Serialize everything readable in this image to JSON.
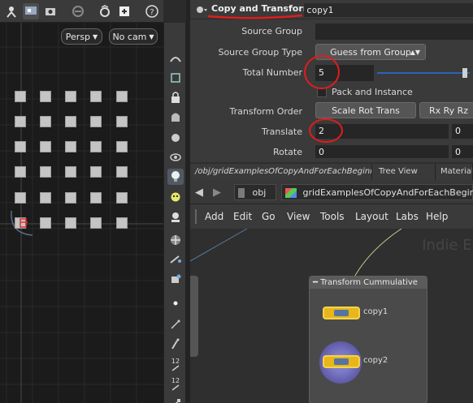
{
  "viewport": {
    "camera_mode": "Persp",
    "camera": "No cam",
    "toolbar_icons": [
      "pose-icon",
      "display-icon",
      "camera-icon",
      "disable-icon",
      "snapshot-icon",
      "render-icon",
      "options-icon",
      "help-icon"
    ]
  },
  "side_tools": [
    "select-icon",
    "transform-icon",
    "lock-icon",
    "light-icon",
    "ghost-icon",
    "eye-icon",
    "skull-icon",
    "dots-icon",
    "pen-icon",
    "rotate-icon",
    "dot-icon",
    "ik-icon",
    "paint-icon",
    "number-icon",
    "number-icon-2"
  ],
  "side_tool_numbers": [
    "12",
    "12"
  ],
  "params": {
    "node_type": "Copy and Transform",
    "node_name": "copy1",
    "rows": {
      "source_group": {
        "label": "Source Group",
        "value": ""
      },
      "source_group_type": {
        "label": "Source Group Type",
        "value": "Guess from Group"
      },
      "total_number": {
        "label": "Total Number",
        "value": "5"
      },
      "pack_instance": {
        "label": "Pack and Instance",
        "checked": false
      },
      "transform_order": {
        "label": "Transform Order",
        "value": "Scale Rot Trans",
        "rot_order": "Rx Ry Rz"
      },
      "translate": {
        "label": "Translate",
        "x": "2",
        "y": "0"
      },
      "rotate": {
        "label": "Rotate",
        "x": "0",
        "y": "0"
      }
    },
    "slider_fraction": 0.97
  },
  "network": {
    "tabs": [
      "/obj/gridExamplesOfCopyAndForEachBeginn...",
      "Tree View",
      "Material Pa..."
    ],
    "path": {
      "root": "obj",
      "node": "gridExamplesOfCopyAndForEachBeginner"
    },
    "menu": [
      "Add",
      "Edit",
      "Go",
      "View",
      "Tools",
      "Layout",
      "Labs",
      "Help"
    ],
    "watermark": "Indie Ed",
    "netbox_title": "Transform Cummulative",
    "nodes": [
      {
        "name": "copy1"
      },
      {
        "name": "copy2"
      }
    ]
  },
  "colors": {
    "annotation": "#e11c1c",
    "node_fill": "#e8b61a",
    "node_highlight": "#f4d34a"
  }
}
